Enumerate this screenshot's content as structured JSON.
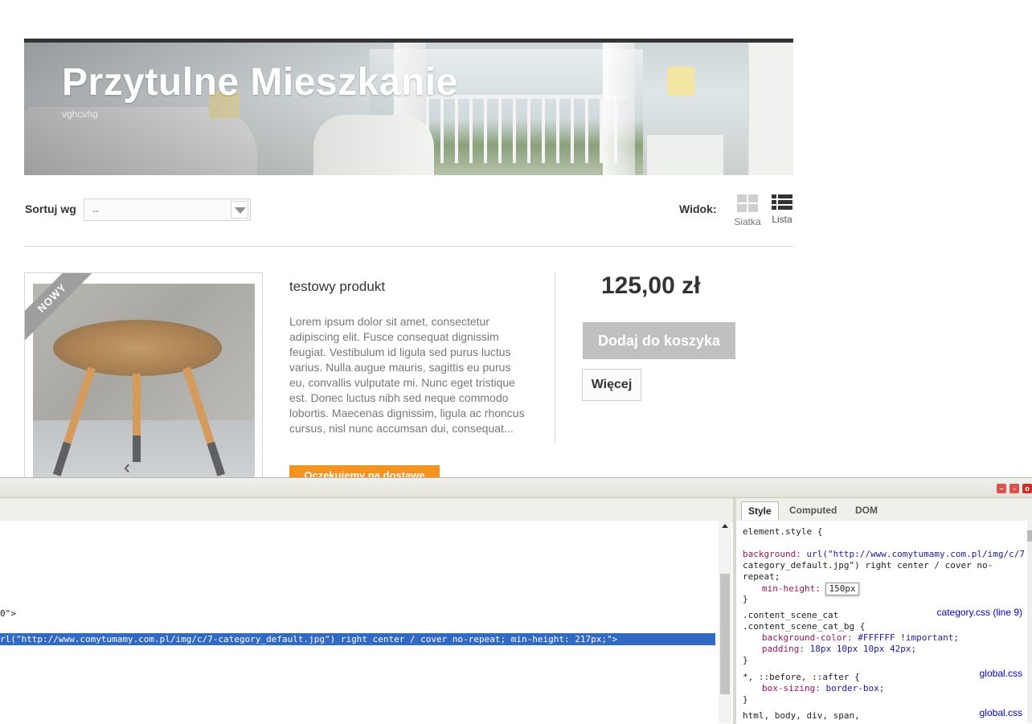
{
  "banner": {
    "title": "Przytulne Mieszkanie",
    "subtitle": "vghcvhg"
  },
  "sortbar": {
    "sort_label": "Sortuj wg",
    "sort_value": "--",
    "view_label": "Widok:",
    "view_grid": "Siatka",
    "view_list": "Lista"
  },
  "product": {
    "badge_new": "NOWY",
    "name": "testowy produkt",
    "description": "Lorem ipsum dolor sit amet, consectetur adipiscing elit. Fusce consequat dignissim feugiat. Vestibulum id ligula sed purus luctus varius. Nulla augue mauris, sagittis eu purus eu, convallis vulputate mi. Nunc eget tristique est. Donec luctus nibh sed neque commodo lobortis. Maecenas dignissim, ligula ac rhoncus cursus, nisl nunc accumsan dui, consequat...",
    "availability": "Oczekujemy na dostawę",
    "price": "125,00 zł",
    "add_to_cart": "Dodaj do koszyka",
    "more": "Więcej"
  },
  "devtools": {
    "tabs": [
      "Style",
      "Computed",
      "DOM"
    ],
    "html_line_1": "0\">",
    "html_line_2": "rl(\"http://www.comytumamy.com.pl/img/c/7-category_default.jpg\") right center / cover no-repeat; min-height: 217px;\">",
    "css": {
      "r1_selector": "element.style {",
      "r1_bg_prop": "background:",
      "r1_bg_val_1": "url(\"http://www.comytumamy.com.pl/img/c/7",
      "r1_bg_val_2": "category_default.jpg\") right center / cover no-",
      "r1_bg_val_3": "repeat;",
      "r1_minh_prop": "min-height:",
      "r1_minh_val": "150px",
      "close": "}",
      "r2_sel_1": ".content_scene_cat",
      "r2_sel_2": ".content_scene_cat_bg {",
      "r2_src": "category.css (line 9)",
      "r2_bgc_prop": "background-color:",
      "r2_bgc_val": "#FFFFFF !important;",
      "r2_pad_prop": "padding:",
      "r2_pad_val": "18px 10px 10px 42px;",
      "r3_sel": "*, ::before, ::after {",
      "r3_src": "global.css",
      "r3_prop": "box-sizing:",
      "r3_val": "border-box;",
      "r4_sel": "html, body, div, span,",
      "r4_src": "global.css"
    }
  }
}
